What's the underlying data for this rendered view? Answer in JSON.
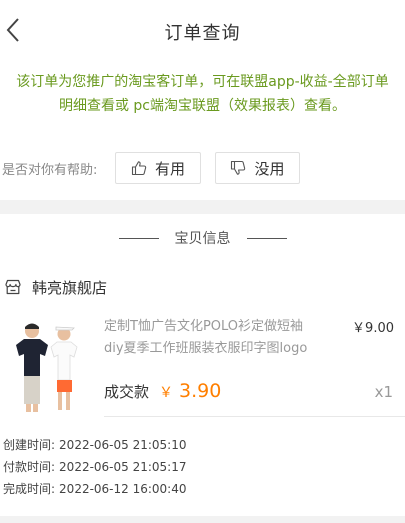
{
  "header": {
    "title": "订单查询",
    "back_icon": "chevron-left-icon"
  },
  "notice": {
    "text": "该订单为您推广的淘宝客订单，可在联盟app-收益-全部订单明细查看或 pc端淘宝联盟（效果报表）查看。",
    "color": "#6a9a1f"
  },
  "feedback": {
    "prompt": "是否对你有帮助:",
    "useful_label": "有用",
    "useful_icon": "thumbs-up-icon",
    "useless_label": "没用",
    "useless_icon": "thumbs-down-icon"
  },
  "section": {
    "title": "宝贝信息"
  },
  "shop": {
    "icon": "shop-icon",
    "name": "韩亮旗舰店"
  },
  "product": {
    "title": "定制T恤广告文化POLO衫定做短袖diy夏季工作班服装衣服印字图logo",
    "price": "￥9.00",
    "deal_label": "成交款",
    "deal_currency": "￥",
    "deal_amount": "3.90",
    "quantity": "x1",
    "accent_color": "#ff7f00"
  },
  "times": [
    {
      "label": "创建时间:",
      "value": "2022-06-05 21:05:10"
    },
    {
      "label": "付款时间:",
      "value": "2022-06-05 21:05:17"
    },
    {
      "label": "完成时间:",
      "value": "2022-06-12 16:00:40"
    }
  ]
}
